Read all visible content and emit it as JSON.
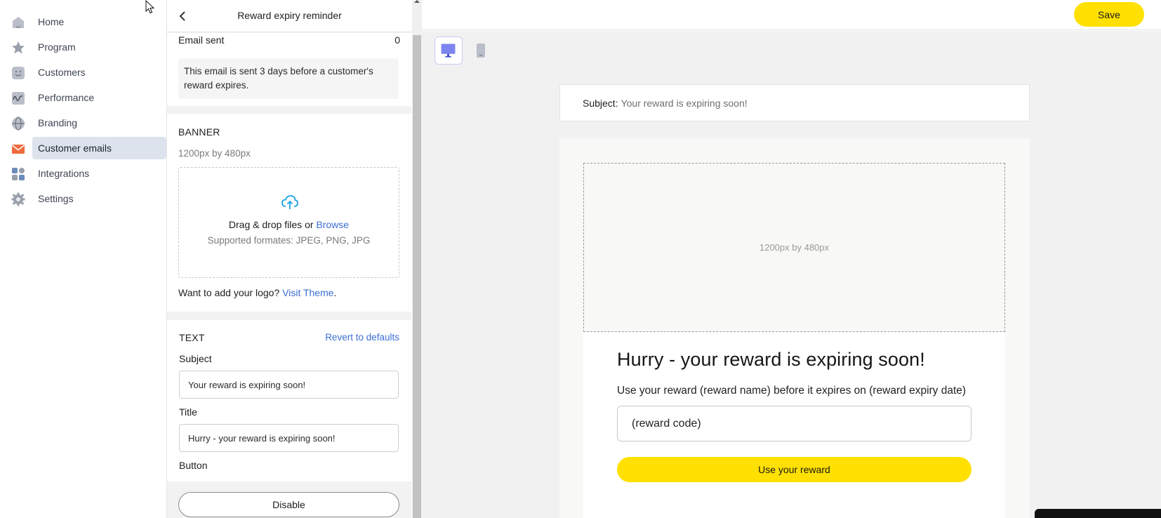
{
  "nav": {
    "items": [
      {
        "label": "Home",
        "icon": "home-icon"
      },
      {
        "label": "Program",
        "icon": "star-icon"
      },
      {
        "label": "Customers",
        "icon": "smiley-icon"
      },
      {
        "label": "Performance",
        "icon": "wave-chart-icon"
      },
      {
        "label": "Branding",
        "icon": "globe-icon"
      },
      {
        "label": "Customer emails",
        "icon": "envelope-icon"
      },
      {
        "label": "Integrations",
        "icon": "apps-grid-icon"
      },
      {
        "label": "Settings",
        "icon": "gear-icon"
      }
    ],
    "active": "Customer emails"
  },
  "panel": {
    "title": "Reward expiry reminder",
    "email_sent_label": "Email sent",
    "email_sent_count": "0",
    "info": "This email is sent 3 days before a customer's reward expires.",
    "banner": {
      "heading": "BANNER",
      "size": "1200px by 480px",
      "drop_text": "Drag & drop files or",
      "browse": "Browse",
      "formats": "Supported formates: JPEG, PNG, JPG",
      "logo_question": "Want to add your logo?",
      "visit_theme": "Visit Theme",
      "period": "."
    },
    "text_section": {
      "heading": "TEXT",
      "revert": "Revert to defaults",
      "subject_label": "Subject",
      "subject_value": "Your reward is expiring soon!",
      "title_label": "Title",
      "title_value": "Hurry - your reward is expiring soon!",
      "button_label": "Button"
    },
    "disable_label": "Disable"
  },
  "toolbar": {
    "save_label": "Save"
  },
  "preview": {
    "subject_key": "Subject:",
    "subject_value": "Your reward is expiring soon!",
    "banner_placeholder": "1200px by 480px",
    "title": "Hurry - your reward is expiring soon!",
    "body": "Use your reward (reward name) before it expires on (reward expiry date)",
    "code": "(reward code)",
    "cta": "Use your reward"
  },
  "colors": {
    "accent": "#ffe000",
    "link": "#3c6fd6",
    "active_nav": "#dde3ec",
    "email_icon": "#f06a3c",
    "device_active": "#5b63e6"
  }
}
